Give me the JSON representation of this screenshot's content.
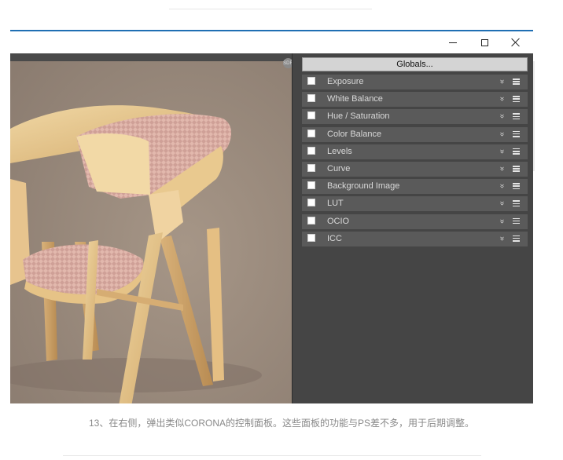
{
  "window": {
    "controls": {
      "minimize_icon": "minimize-icon",
      "maximize_icon": "maximize-icon",
      "close_icon": "close-icon"
    },
    "accent_color": "#1f6fb3",
    "panel_bg": "#454545"
  },
  "viewport": {
    "badge_text": "SDR",
    "render_subject": "wooden armchair with pink woven seat"
  },
  "panel": {
    "globals_label": "Globals...",
    "layers": [
      {
        "label": "Exposure"
      },
      {
        "label": "White Balance"
      },
      {
        "label": "Hue / Saturation"
      },
      {
        "label": "Color Balance"
      },
      {
        "label": "Levels"
      },
      {
        "label": "Curve"
      },
      {
        "label": "Background Image"
      },
      {
        "label": "LUT"
      },
      {
        "label": "OCIO"
      },
      {
        "label": "ICC"
      }
    ],
    "row_icons": [
      "chevron-double-down-icon",
      "menu-icon"
    ]
  },
  "caption": {
    "text": "13、在右侧，弹出类似CORONA的控制面板。这些面板的功能与PS差不多，用于后期调整。"
  }
}
